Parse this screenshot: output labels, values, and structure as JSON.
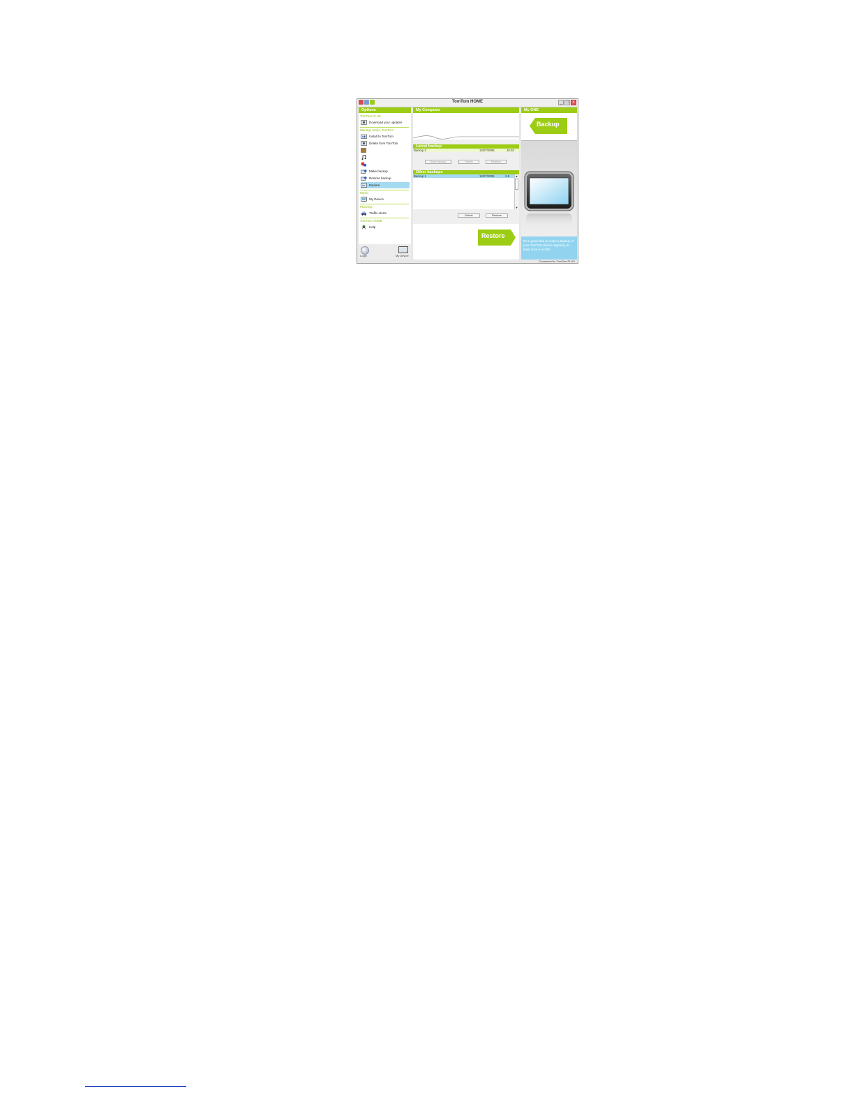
{
  "window": {
    "title": "TomTom HOME",
    "status": "Connected to TomTom PLUS"
  },
  "options": {
    "header": "Options",
    "sections": [
      {
        "label": "TomTom PLUS"
      },
      {
        "label": "Manage maps, TomTom"
      },
      {
        "label": "Music"
      },
      {
        "label": "Planning"
      },
      {
        "label": "TomTom HOME"
      }
    ],
    "items": [
      {
        "label": "Download your updates",
        "icon": "download-icon"
      },
      {
        "label": "Install to TomTom",
        "icon": "install-icon"
      },
      {
        "label": "Delete from TomTom",
        "icon": "delete-icon"
      },
      {
        "label": "",
        "icon": "image-icon"
      },
      {
        "label": "",
        "icon": "music-note-icon"
      },
      {
        "label": "",
        "icon": "voice-icon"
      },
      {
        "label": "Make backup",
        "icon": "make-backup-icon"
      },
      {
        "label": "Restore backup",
        "icon": "restore-backup-icon"
      },
      {
        "label": "Explore",
        "icon": "explore-icon"
      },
      {
        "label": "My Device",
        "icon": "device-icon"
      },
      {
        "label": "Traffic Alerts",
        "icon": "traffic-icon"
      },
      {
        "label": "Help",
        "icon": "help-icon"
      }
    ],
    "footer": {
      "logo_label": "Login",
      "device_label": "My Device"
    }
  },
  "my_computer": {
    "header": "My Computer",
    "latest_backup": {
      "header": "Latest backup",
      "row": {
        "name": "Backup 2",
        "date": "12/07/2006",
        "size": "10.03"
      },
      "buttons": [
        "Save backup",
        "Delete",
        "Restore"
      ]
    },
    "other_backups": {
      "header": "Other backups",
      "rows": [
        {
          "name": "Backup 1",
          "date": "12/07/2006",
          "size": "2.8 MB"
        }
      ],
      "buttons": [
        "Delete",
        "Restore"
      ]
    },
    "restore_label": "Restore"
  },
  "my_one": {
    "header": "My ONE",
    "backup_label": "Backup",
    "tip": "It's a good idea to make a backup of your TomTom device regularly, at least once a month."
  },
  "colors": {
    "accent": "#9ccc13",
    "selection": "#a5dbf0",
    "tip_bg": "#92d4ef"
  }
}
